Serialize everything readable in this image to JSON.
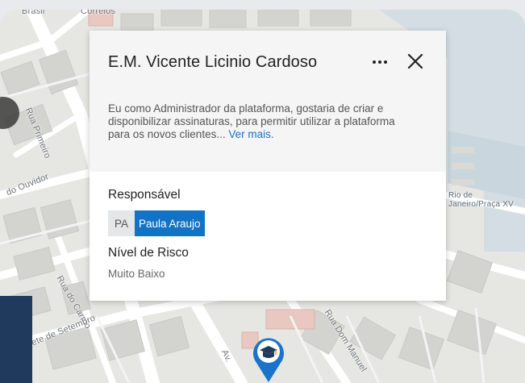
{
  "map": {
    "street_labels": [
      "Brasil",
      "Correios",
      "Rua Primeiro",
      "do Ouvidor",
      "Rua do Carmo",
      "Rua Sete de Setembro",
      "Av.",
      "Rua Dom Manuel",
      "Rio de Janeiro/Praça XV"
    ],
    "marker_icon": "graduation-cap-icon"
  },
  "card": {
    "title": "E.M. Vicente Licinio Cardoso",
    "description": "Eu como Administrador da plataforma, gostaria de criar e disponibilizar assinaturas, para permitir utilizar a plataforma para os novos clientes...",
    "see_more": "Ver mais.",
    "responsible_label": "Responsável",
    "responsible_initials": "PA",
    "responsible_name": "Paula Araujo",
    "risk_label": "Nível de Risco",
    "risk_value": "Muito Baixo"
  },
  "colors": {
    "accent": "#1273c4",
    "link": "#1a73c8",
    "marker": "#1a73c8"
  }
}
